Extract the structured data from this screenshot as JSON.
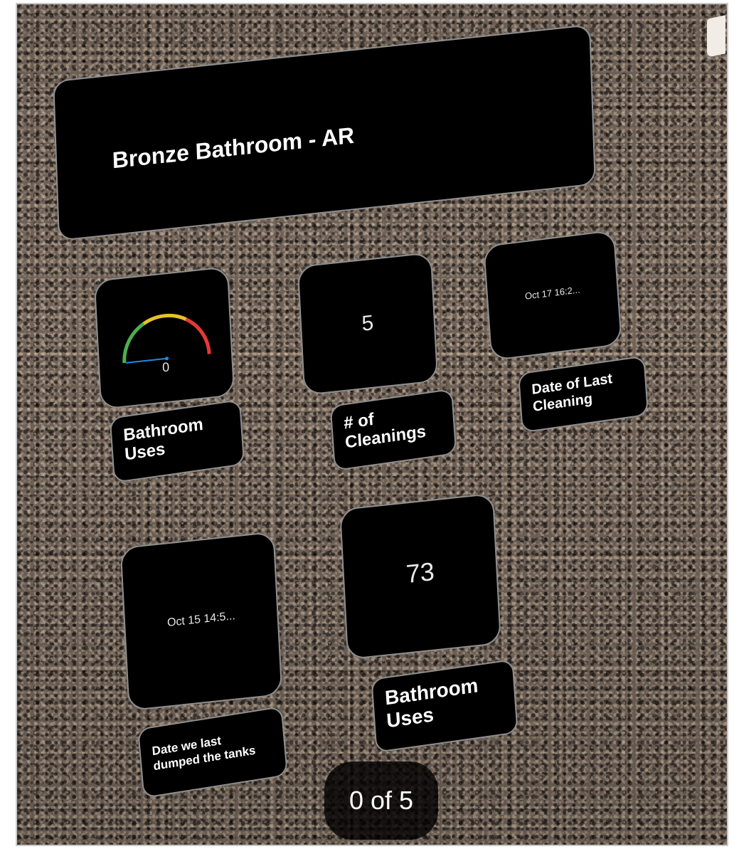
{
  "title": "Bronze Bathroom - AR",
  "tiles": {
    "gauge": {
      "value_text": "0",
      "value": 0
    },
    "cleanings_count": {
      "value": "5"
    },
    "last_cleaning_date": {
      "value": "Oct 17 16:2..."
    },
    "last_dump_date": {
      "value": "Oct 15 14:5..."
    },
    "bathroom_uses_count": {
      "value": "73"
    }
  },
  "labels": {
    "bathroom_uses_1": [
      "Bathroom",
      "Uses"
    ],
    "cleanings": [
      "# of",
      "Cleanings"
    ],
    "date_last_cleaning": [
      "Date of Last",
      "Cleaning"
    ],
    "date_dumped": [
      "Date we last",
      "dumped the tanks"
    ],
    "bathroom_uses_2": [
      "Bathroom",
      "Uses"
    ]
  },
  "pager": {
    "text": "0 of 5"
  },
  "colors": {
    "gauge_green": "#4caf50",
    "gauge_yellow": "#e6c229",
    "gauge_red": "#e53935",
    "gauge_needle": "#1e88e5"
  }
}
